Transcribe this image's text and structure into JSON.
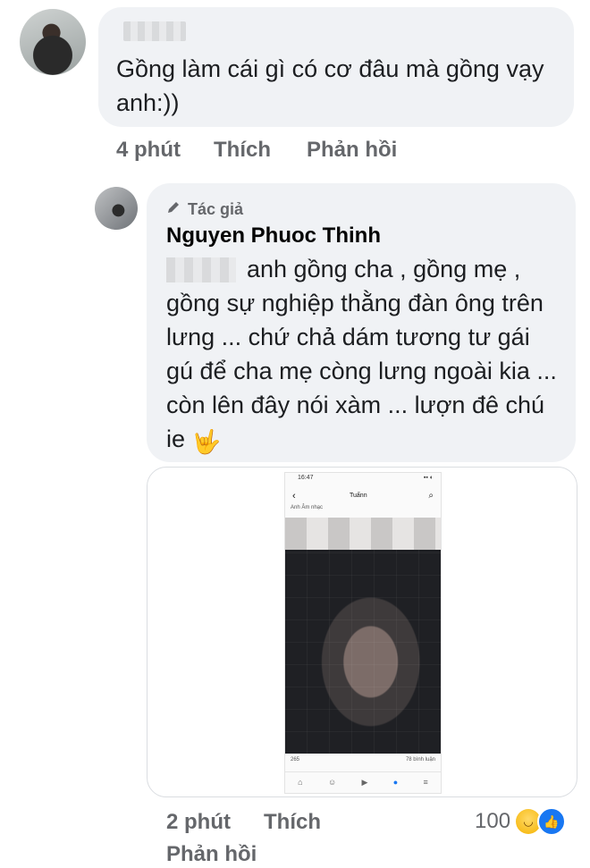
{
  "comment1": {
    "text": "Gồng làm cái gì có cơ đâu mà gồng vạy anh:))",
    "time": "4 phút",
    "like_label": "Thích",
    "reply_label": "Phản hồi"
  },
  "comment2": {
    "badge": "Tác giả",
    "author": "Nguyen Phuoc Thinh",
    "text": "anh gồng cha , gồng mẹ , gồng sự nghiệp thằng đàn ông trên lưng ... chứ chả dám tương tư gái gú để cha mẹ còng lưng ngoài kia ... còn lên đây nói xàm ... lượn đê chú ie",
    "emoji": "🤟",
    "time": "2 phút",
    "like_label": "Thích",
    "reply_label": "Phản hồi",
    "reaction_count": "100"
  },
  "screenshot": {
    "status_time": "16:47",
    "title": "Tuấnn",
    "tags": "Anh   Âm nhạc",
    "likes_left": "265",
    "likes_right": "78 bình luận"
  },
  "icons": {
    "pencil": "pencil-icon",
    "haha": "haha-reaction-icon",
    "like": "like-reaction-icon"
  }
}
